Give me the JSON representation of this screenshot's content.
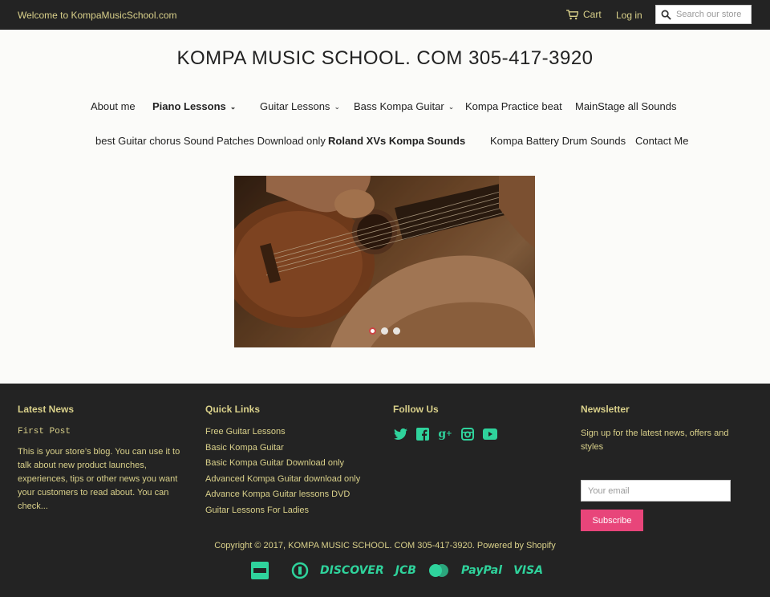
{
  "topbar": {
    "welcome": "Welcome to KompaMusicSchool.com",
    "cart_label": "Cart",
    "login_label": "Log in",
    "search_placeholder": "Search our store"
  },
  "header": {
    "title": "KOMPA MUSIC SCHOOL. COM 305-417-3920"
  },
  "nav": {
    "row1": [
      {
        "label": "About me"
      },
      {
        "label": "Piano Lessons"
      },
      {
        "label": "Guitar Lessons"
      },
      {
        "label": "Bass Kompa Guitar"
      },
      {
        "label": "Kompa Practice beat"
      },
      {
        "label": "MainStage all Sounds"
      }
    ],
    "row2": [
      {
        "label": "best Guitar chorus Sound Patches Download only"
      },
      {
        "label": "Roland XVs Kompa Sounds"
      },
      {
        "label": "Kompa Battery Drum Sounds"
      },
      {
        "label": "Contact Me"
      }
    ]
  },
  "slideshow": {
    "slide_count": 3,
    "active_slide": 1
  },
  "footer": {
    "latest_news": {
      "heading": "Latest News",
      "post_title": "First Post",
      "excerpt": "This is your store’s blog. You can use it to talk about new product launches, experiences, tips or other news you want your customers to read about. You can check..."
    },
    "quick_links": {
      "heading": "Quick Links",
      "items": [
        "Free Guitar Lessons",
        "Basic Kompa Guitar",
        "Basic Kompa Guitar Download only",
        "Advanced Kompa Guitar download only",
        "Advance Kompa Guitar lessons DVD",
        "Guitar Lessons For Ladies"
      ]
    },
    "follow_us": {
      "heading": "Follow Us",
      "icons": [
        "twitter-icon",
        "facebook-icon",
        "google-plus-icon",
        "instagram-icon",
        "youtube-icon"
      ]
    },
    "newsletter": {
      "heading": "Newsletter",
      "text": "Sign up for the latest news, offers and styles",
      "email_placeholder": "Your email",
      "button_label": "Subscribe"
    },
    "copyright": "Copyright © 2017, KOMPA MUSIC SCHOOL. COM 305-417-3920. Powered by Shopify",
    "payments": {
      "discover": "DISCOVER",
      "jcb": "JCB",
      "paypal": "PayPal",
      "visa": "VISA"
    }
  },
  "colors": {
    "bar_bg": "#232323",
    "footer_text": "#d9d08a",
    "icon_accent": "#2fd39c",
    "subscribe_button": "#e8457a"
  }
}
